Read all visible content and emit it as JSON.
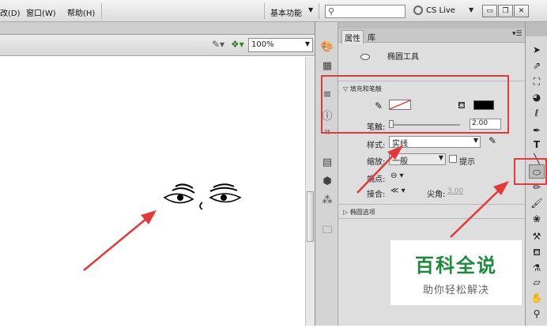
{
  "menubar": {
    "items": [
      "改(D)",
      "窗口(W)",
      "帮助(H)"
    ],
    "workspace_label": "基本功能",
    "search_placeholder": "",
    "cs_live_label": "CS Live"
  },
  "edit_bar": {
    "zoom_value": "100%"
  },
  "properties": {
    "tabs": [
      "属性",
      "库"
    ],
    "tool_name": "椭圆工具",
    "fill_stroke_section": "填充和笔触",
    "stroke_width_label": "笔触:",
    "stroke_width_value": "2.00",
    "style_label": "样式:",
    "style_value": "实线",
    "scale_label": "缩放:",
    "scale_value": "一般",
    "hint_label": "提示",
    "cap_label": "端点:",
    "join_label": "接合:",
    "miter_label": "尖角:",
    "miter_value": "3.00",
    "oval_options_section": "椭圆选项",
    "colors": {
      "stroke": "none",
      "fill": "#000000"
    }
  },
  "toolbar": {
    "tools": [
      "selection-arrow",
      "subselect-arrow",
      "free-transform",
      "3d-rotation",
      "lasso",
      "pen",
      "text",
      "line",
      "oval",
      "pencil",
      "brush",
      "deco",
      "bone",
      "paint-bucket",
      "eyedropper",
      "eraser",
      "hand",
      "zoom"
    ]
  },
  "watermark": {
    "title": "百科全说",
    "subtitle": "助你轻松解决"
  },
  "annotation_color": "#e03a3a"
}
